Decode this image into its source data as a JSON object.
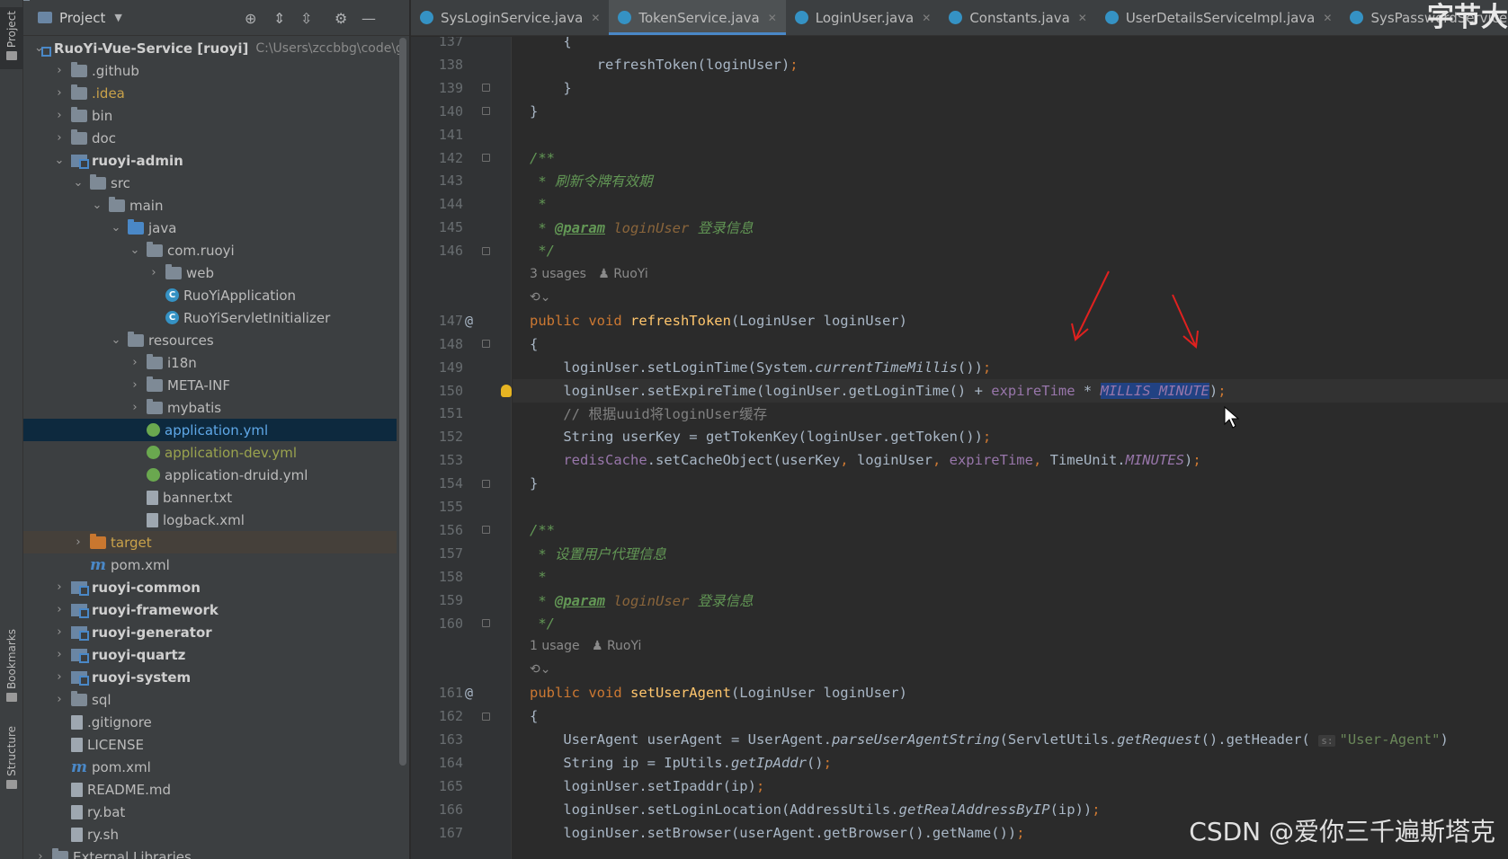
{
  "toolstrip": {
    "project_tab": "Project",
    "bookmarks_tab": "Bookmarks",
    "structure_tab": "Structure"
  },
  "project_panel": {
    "title": "Project",
    "tree": [
      {
        "label": "RuoYi-Vue-Service [ruoyi]",
        "path": "C:\\Users\\zccbbg\\code\\g",
        "depth": 0,
        "arrow": "open",
        "icon": "module",
        "style": "bold"
      },
      {
        "label": ".github",
        "depth": 1,
        "arrow": "closed",
        "icon": "folder"
      },
      {
        "label": ".idea",
        "depth": 1,
        "arrow": "closed",
        "icon": "folder",
        "style": "idea"
      },
      {
        "label": "bin",
        "depth": 1,
        "arrow": "closed",
        "icon": "folder"
      },
      {
        "label": "doc",
        "depth": 1,
        "arrow": "closed",
        "icon": "folder"
      },
      {
        "label": "ruoyi-admin",
        "depth": 1,
        "arrow": "open",
        "icon": "module",
        "style": "bold"
      },
      {
        "label": "src",
        "depth": 2,
        "arrow": "open",
        "icon": "folder"
      },
      {
        "label": "main",
        "depth": 3,
        "arrow": "open",
        "icon": "folder"
      },
      {
        "label": "java",
        "depth": 4,
        "arrow": "open",
        "icon": "folder-blue"
      },
      {
        "label": "com.ruoyi",
        "depth": 5,
        "arrow": "open",
        "icon": "folder"
      },
      {
        "label": "web",
        "depth": 6,
        "arrow": "closed",
        "icon": "folder"
      },
      {
        "label": "RuoYiApplication",
        "depth": 6,
        "arrow": "none",
        "icon": "class"
      },
      {
        "label": "RuoYiServletInitializer",
        "depth": 6,
        "arrow": "none",
        "icon": "class"
      },
      {
        "label": "resources",
        "depth": 4,
        "arrow": "open",
        "icon": "folder"
      },
      {
        "label": "i18n",
        "depth": 5,
        "arrow": "closed",
        "icon": "folder"
      },
      {
        "label": "META-INF",
        "depth": 5,
        "arrow": "closed",
        "icon": "folder"
      },
      {
        "label": "mybatis",
        "depth": 5,
        "arrow": "closed",
        "icon": "folder"
      },
      {
        "label": "application.yml",
        "depth": 5,
        "arrow": "none",
        "icon": "yml",
        "style": "selected"
      },
      {
        "label": "application-dev.yml",
        "depth": 5,
        "arrow": "none",
        "icon": "yml",
        "style": "olive"
      },
      {
        "label": "application-druid.yml",
        "depth": 5,
        "arrow": "none",
        "icon": "yml"
      },
      {
        "label": "banner.txt",
        "depth": 5,
        "arrow": "none",
        "icon": "file"
      },
      {
        "label": "logback.xml",
        "depth": 5,
        "arrow": "none",
        "icon": "file"
      },
      {
        "label": "target",
        "depth": 2,
        "arrow": "closed",
        "icon": "folder-orange",
        "style": "target"
      },
      {
        "label": "pom.xml",
        "depth": 2,
        "arrow": "none",
        "icon": "maven"
      },
      {
        "label": "ruoyi-common",
        "depth": 1,
        "arrow": "closed",
        "icon": "module",
        "style": "bold"
      },
      {
        "label": "ruoyi-framework",
        "depth": 1,
        "arrow": "closed",
        "icon": "module",
        "style": "bold"
      },
      {
        "label": "ruoyi-generator",
        "depth": 1,
        "arrow": "closed",
        "icon": "module",
        "style": "bold"
      },
      {
        "label": "ruoyi-quartz",
        "depth": 1,
        "arrow": "closed",
        "icon": "module",
        "style": "bold"
      },
      {
        "label": "ruoyi-system",
        "depth": 1,
        "arrow": "closed",
        "icon": "module",
        "style": "bold"
      },
      {
        "label": "sql",
        "depth": 1,
        "arrow": "closed",
        "icon": "folder"
      },
      {
        "label": ".gitignore",
        "depth": 1,
        "arrow": "none",
        "icon": "file"
      },
      {
        "label": "LICENSE",
        "depth": 1,
        "arrow": "none",
        "icon": "file"
      },
      {
        "label": "pom.xml",
        "depth": 1,
        "arrow": "none",
        "icon": "maven"
      },
      {
        "label": "README.md",
        "depth": 1,
        "arrow": "none",
        "icon": "file"
      },
      {
        "label": "ry.bat",
        "depth": 1,
        "arrow": "none",
        "icon": "file"
      },
      {
        "label": "ry.sh",
        "depth": 1,
        "arrow": "none",
        "icon": "file"
      },
      {
        "label": "External Libraries",
        "depth": 0,
        "arrow": "closed",
        "icon": "folder"
      }
    ]
  },
  "tabs": [
    {
      "label": "SysLoginService.java",
      "active": false
    },
    {
      "label": "TokenService.java",
      "active": true
    },
    {
      "label": "LoginUser.java",
      "active": false
    },
    {
      "label": "Constants.java",
      "active": false
    },
    {
      "label": "UserDetailsServiceImpl.java",
      "active": false
    },
    {
      "label": "SysPasswordService.java",
      "active": false
    }
  ],
  "editor": {
    "lines": [
      {
        "n": "137",
        "segs": [
          [
            "",
            "    {"
          ]
        ]
      },
      {
        "n": "138",
        "segs": [
          [
            "",
            "        refreshToken(loginUser)"
          ],
          [
            "kw",
            ";"
          ]
        ]
      },
      {
        "n": "139",
        "segs": [
          [
            "",
            "    }"
          ]
        ],
        "fold": true
      },
      {
        "n": "140",
        "segs": [
          [
            "",
            "}"
          ]
        ],
        "fold": true
      },
      {
        "n": "141",
        "segs": [
          [
            "",
            ""
          ]
        ]
      },
      {
        "n": "142",
        "segs": [
          [
            "cm",
            "/**"
          ]
        ],
        "fold": true
      },
      {
        "n": "143",
        "segs": [
          [
            "cm",
            " * 刷新令牌有效期"
          ]
        ]
      },
      {
        "n": "144",
        "segs": [
          [
            "cm",
            " *"
          ]
        ]
      },
      {
        "n": "145",
        "segs": [
          [
            "cm",
            " * "
          ],
          [
            "tag",
            "@param"
          ],
          [
            "param",
            " loginUser"
          ],
          [
            "cm",
            " 登录信息"
          ]
        ]
      },
      {
        "n": "146",
        "segs": [
          [
            "cm",
            " */"
          ]
        ],
        "fold": true
      },
      {
        "hint": "3 usages   ♟ RuoYi"
      },
      {
        "hint": "⟲⌄"
      },
      {
        "n": "147",
        "mark": "@",
        "segs": [
          [
            "kw",
            "public void "
          ],
          [
            "fn",
            "refreshToken"
          ],
          [
            "",
            "(LoginUser loginUser)"
          ]
        ]
      },
      {
        "n": "148",
        "segs": [
          [
            "",
            "{"
          ]
        ],
        "fold": true
      },
      {
        "n": "149",
        "segs": [
          [
            "",
            "    loginUser.setLoginTime(System."
          ],
          [
            "sm",
            "currentTimeMillis"
          ],
          [
            "",
            "())"
          ],
          [
            "kw",
            ";"
          ]
        ]
      },
      {
        "n": "150",
        "current": true,
        "bulb": true,
        "segs": [
          [
            "",
            "    loginUser.setExpireTime(loginUser.getLoginTime() + "
          ],
          [
            "fld",
            "expireTime"
          ],
          [
            "",
            " * "
          ],
          [
            "sel",
            "MILLIS_MINUTE"
          ],
          [
            "",
            ")"
          ],
          [
            "kw",
            ";"
          ]
        ]
      },
      {
        "n": "151",
        "segs": [
          [
            "cmline",
            "    // 根据uuid将loginUser缓存"
          ]
        ]
      },
      {
        "n": "152",
        "segs": [
          [
            "",
            "    String userKey = getTokenKey(loginUser.getToken())"
          ],
          [
            "kw",
            ";"
          ]
        ]
      },
      {
        "n": "153",
        "segs": [
          [
            "fld",
            "    redisCache"
          ],
          [
            "",
            ".setCacheObject(userKey"
          ],
          [
            "kw",
            ", "
          ],
          [
            "",
            "loginUser"
          ],
          [
            "kw",
            ", "
          ],
          [
            "fld",
            "expireTime"
          ],
          [
            "kw",
            ", "
          ],
          [
            "",
            "TimeUnit."
          ],
          [
            "stat",
            "MINUTES"
          ],
          [
            "",
            ")"
          ],
          [
            "kw",
            ";"
          ]
        ]
      },
      {
        "n": "154",
        "segs": [
          [
            "",
            "}"
          ]
        ],
        "fold": true
      },
      {
        "n": "155",
        "segs": [
          [
            "",
            ""
          ]
        ]
      },
      {
        "n": "156",
        "segs": [
          [
            "cm",
            "/**"
          ]
        ],
        "fold": true
      },
      {
        "n": "157",
        "segs": [
          [
            "cm",
            " * 设置用户代理信息"
          ]
        ]
      },
      {
        "n": "158",
        "segs": [
          [
            "cm",
            " *"
          ]
        ]
      },
      {
        "n": "159",
        "segs": [
          [
            "cm",
            " * "
          ],
          [
            "tag",
            "@param"
          ],
          [
            "param",
            " loginUser"
          ],
          [
            "cm",
            " 登录信息"
          ]
        ]
      },
      {
        "n": "160",
        "segs": [
          [
            "cm",
            " */"
          ]
        ],
        "fold": true
      },
      {
        "hint": "1 usage   ♟ RuoYi"
      },
      {
        "hint": "⟲⌄"
      },
      {
        "n": "161",
        "mark": "@",
        "segs": [
          [
            "kw",
            "public void "
          ],
          [
            "fn",
            "setUserAgent"
          ],
          [
            "",
            "(LoginUser loginUser)"
          ]
        ]
      },
      {
        "n": "162",
        "segs": [
          [
            "",
            "{"
          ]
        ],
        "fold": true
      },
      {
        "n": "163",
        "segs": [
          [
            "",
            "    UserAgent userAgent = UserAgent."
          ],
          [
            "sm",
            "parseUserAgentString"
          ],
          [
            "",
            "(ServletUtils."
          ],
          [
            "sm",
            "getRequest"
          ],
          [
            "",
            "().getHeader( "
          ],
          [
            "ph",
            "s:"
          ],
          [
            "str",
            "\"User-Agent\""
          ],
          [
            "",
            ")"
          ]
        ]
      },
      {
        "n": "164",
        "segs": [
          [
            "",
            "    String ip = IpUtils."
          ],
          [
            "sm",
            "getIpAddr"
          ],
          [
            "",
            "()"
          ],
          [
            "kw",
            ";"
          ]
        ]
      },
      {
        "n": "165",
        "segs": [
          [
            "",
            "    loginUser.setIpaddr(ip)"
          ],
          [
            "kw",
            ";"
          ]
        ]
      },
      {
        "n": "166",
        "segs": [
          [
            "",
            "    loginUser.setLoginLocation(AddressUtils."
          ],
          [
            "sm",
            "getRealAddressByIP"
          ],
          [
            "",
            "(ip))"
          ],
          [
            "kw",
            ";"
          ]
        ]
      },
      {
        "n": "167",
        "segs": [
          [
            "",
            "    loginUser.setBrowser(userAgent.getBrowser().getName())"
          ],
          [
            "kw",
            ";"
          ]
        ]
      }
    ]
  },
  "overlay": {
    "watermark": "CSDN @爱你三千遍斯塔克",
    "corner_text": "字节大"
  }
}
